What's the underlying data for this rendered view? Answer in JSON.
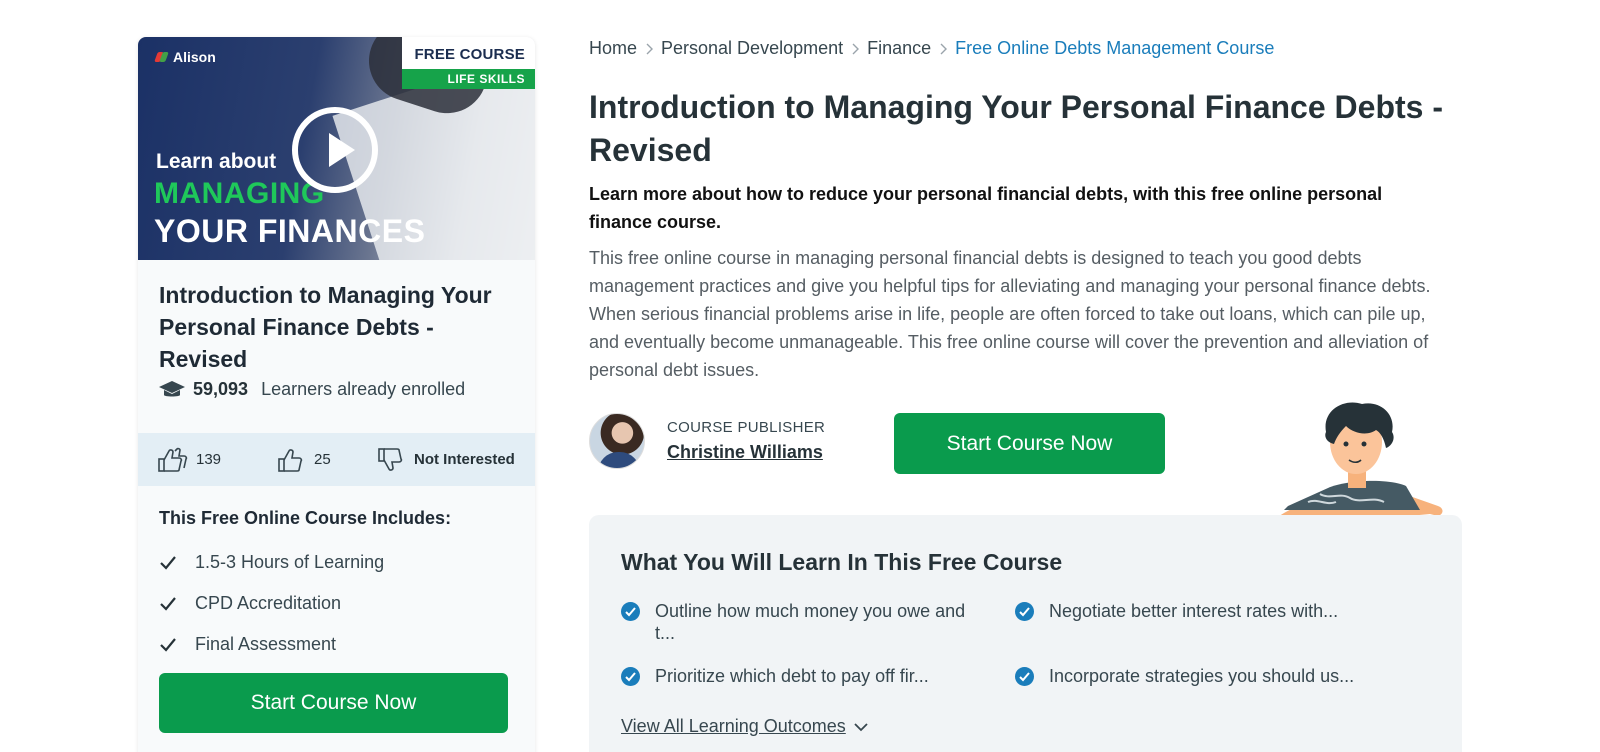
{
  "card": {
    "thumbnail": {
      "logo": "Alison",
      "badge_top": "FREE COURSE",
      "badge_bottom": "LIFE SKILLS",
      "line1": "Learn about",
      "line2": "MANAGING",
      "line3": "YOUR FINANCES",
      "play_icon": "play-icon"
    },
    "title": "Introduction to Managing Your Personal Finance Debts - Revised",
    "enrolled_count": "59,093",
    "enrolled_text": "Learners already enrolled",
    "reactions": {
      "recommend_count": "139",
      "like_count": "25",
      "not_interested": "Not Interested"
    },
    "includes_title": "This Free Online Course Includes:",
    "includes": [
      "1.5-3 Hours of Learning",
      "CPD Accreditation",
      "Final Assessment"
    ],
    "cta": "Start Course Now"
  },
  "breadcrumb": [
    "Home",
    "Personal Development",
    "Finance",
    "Free Online Debts Management Course"
  ],
  "course": {
    "title": "Introduction to Managing Your Personal Finance Debts - Revised",
    "subtitle": "Learn more about how to reduce your personal financial debts, with this free online personal finance course.",
    "description": "This free online course in managing personal financial debts is designed to teach you good debts management practices and give you helpful tips for alleviating and managing your personal finance debts. When serious financial problems arise in life, people are often forced to take out loans, which can pile up, and eventually become unmanageable. This free online course will cover the prevention and alleviation of personal debt issues.",
    "publisher_label": "COURSE PUBLISHER",
    "publisher_name": "Christine Williams",
    "cta": "Start Course Now"
  },
  "learn": {
    "title": "What You Will Learn In This Free Course",
    "outcomes": [
      "Outline how much money you owe and t...",
      "Negotiate better interest rates with...",
      "Prioritize which debt to pay off fir...",
      "Incorporate strategies you should us..."
    ],
    "view_all": "View All Learning Outcomes"
  },
  "colors": {
    "accent_green": "#0a9b4d",
    "link_blue": "#1a7dbb",
    "reaction_bar": "#e3eef5",
    "learn_bg": "#f1f4f6"
  }
}
